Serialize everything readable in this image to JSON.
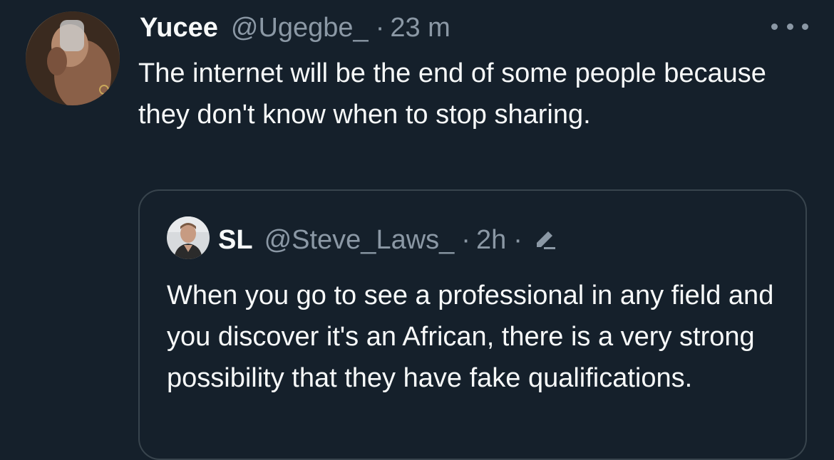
{
  "tweet": {
    "display_name": "Yucee",
    "handle": "@Ugegbe_",
    "separator": "·",
    "time": "23 m",
    "text": "The internet will be the end of some people because they don't know when to stop sharing.",
    "more_icon": "more-horizontal-icon"
  },
  "quoted_tweet": {
    "display_name": "SL",
    "handle": "@Steve_Laws_",
    "separator": "·",
    "time": "2h",
    "edit_separator": "·",
    "edit_icon": "edited-pencil-icon",
    "text": "When you go to see a professional in any field and you discover it's an African, there is a very strong possibility that they have fake qualifications."
  },
  "colors": {
    "background": "#15202b",
    "primary_text": "#f7f9f9",
    "secondary_text": "#8b98a5",
    "border": "#38444d"
  }
}
